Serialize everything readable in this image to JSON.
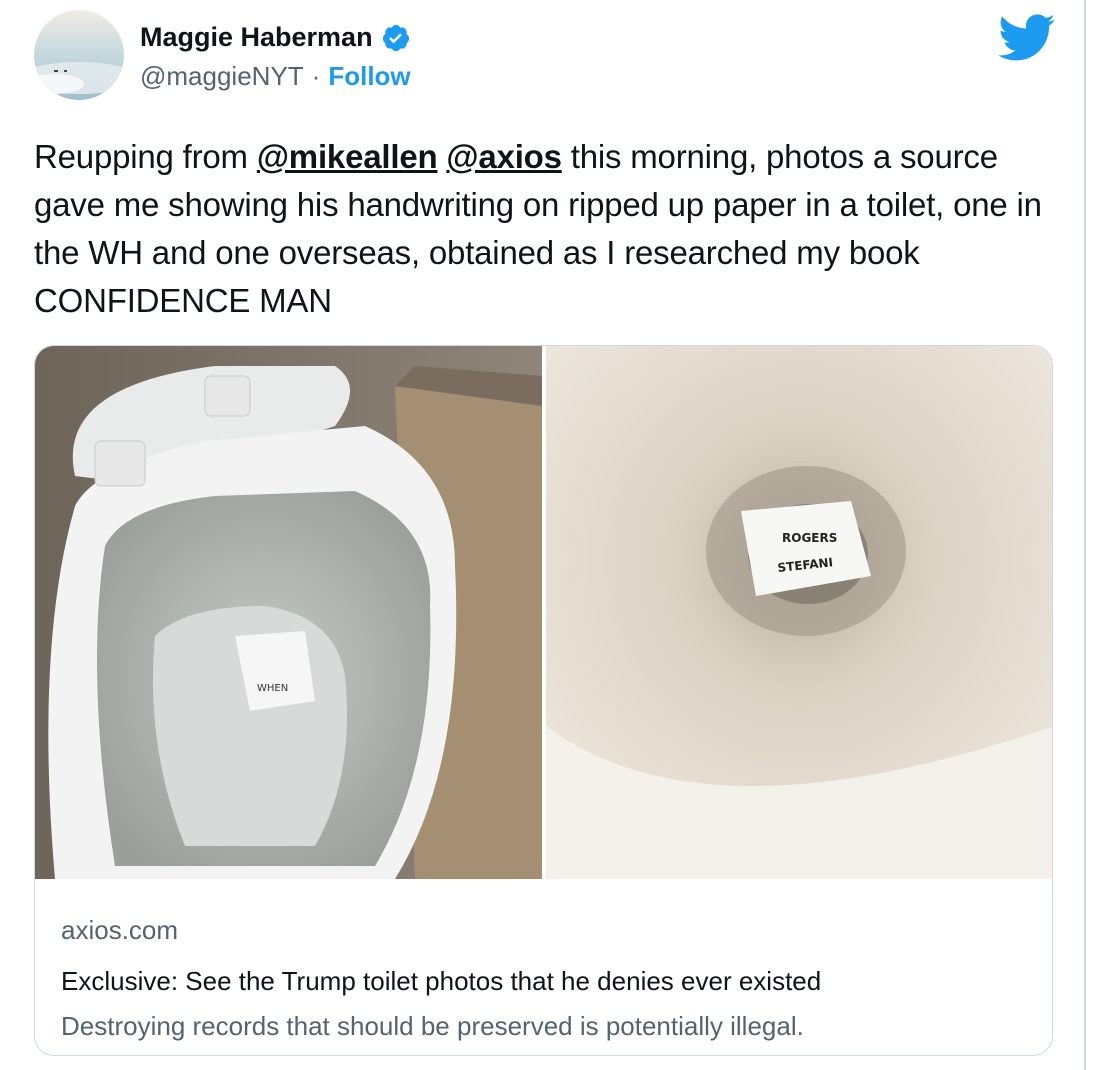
{
  "author": {
    "name": "Maggie Haberman",
    "handle": "@maggieNYT",
    "separator": "·",
    "follow_label": "Follow",
    "verified_icon": "verified-badge-icon"
  },
  "tweet": {
    "text_before": "Reupping from ",
    "mention1": "@mikeallen",
    "space": " ",
    "mention2": "@axios",
    "text_after": " this morning, photos a source gave me showing his handwriting on ripped up paper in a toilet, one in the WH and one overseas, obtained as I researched my book CONFIDENCE MAN"
  },
  "card": {
    "domain": "axios.com",
    "title": "Exclusive: See the Trump toilet photos that he denies ever existed",
    "description": "Destroying records that should be preserved is potentially illegal.",
    "photo_right_labels": [
      "ROGERS",
      "STEFANI"
    ],
    "photo_left_label": "WHEN"
  },
  "colors": {
    "accent": "#1d9bf0",
    "text": "#0f1419",
    "secondary": "#536471",
    "border": "#cfd9de"
  }
}
